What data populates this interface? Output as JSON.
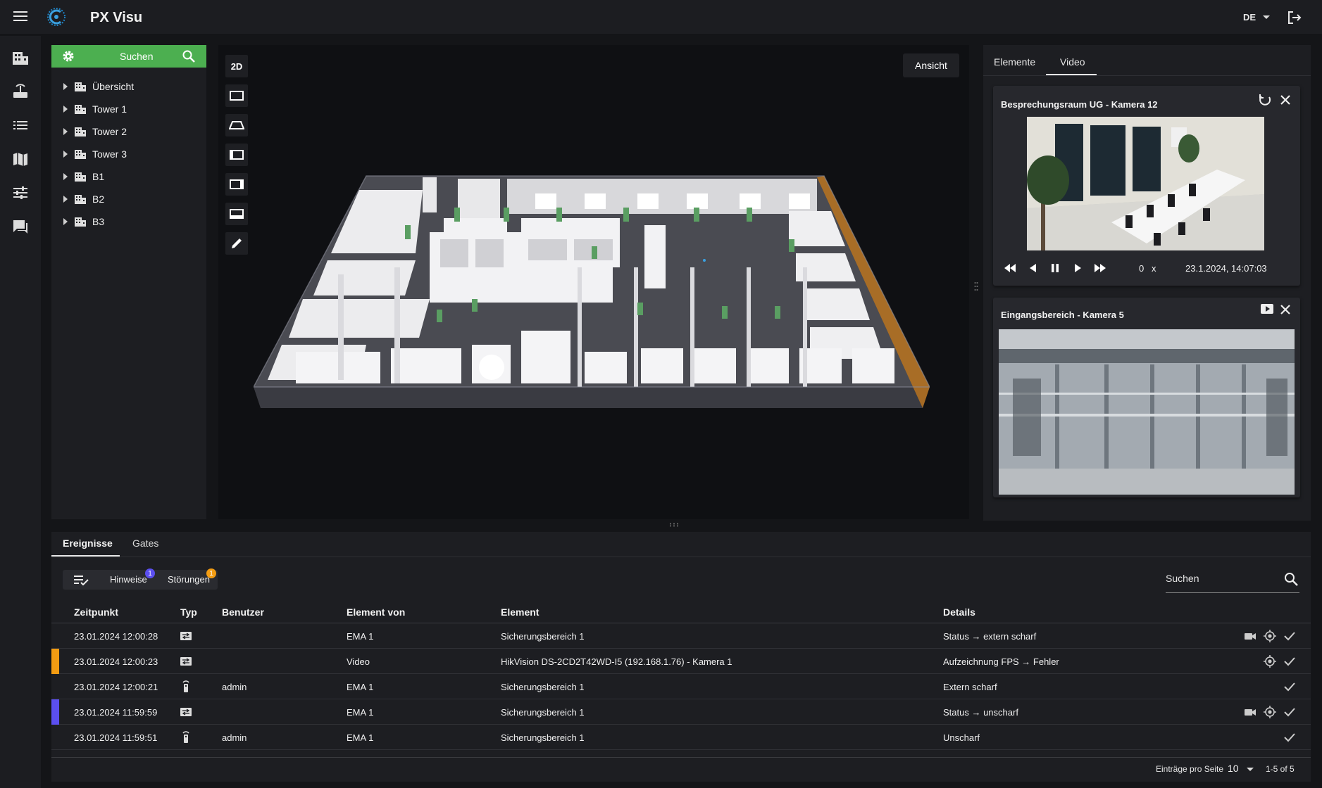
{
  "app": {
    "title": "PX Visu",
    "language": "DE"
  },
  "icons": {
    "menu": "menu-icon",
    "logo": "px-logo",
    "logout": "logout-icon",
    "rail": [
      "building-icon",
      "network-icon",
      "list-icon",
      "map-icon",
      "sliders-icon",
      "chat-icon"
    ]
  },
  "tree": {
    "search_label": "Suchen",
    "items": [
      {
        "label": "Übersicht"
      },
      {
        "label": "Tower 1"
      },
      {
        "label": "Tower 2"
      },
      {
        "label": "Tower 3"
      },
      {
        "label": "B1"
      },
      {
        "label": "B2"
      },
      {
        "label": "B3"
      }
    ]
  },
  "view": {
    "mode_2d_label": "2D",
    "ansicht_label": "Ansicht",
    "tools": [
      "view-top-icon",
      "view-perspective-icon",
      "view-left-icon",
      "view-right-icon",
      "view-bottom-icon",
      "pencil-icon"
    ]
  },
  "right_panel": {
    "tabs": [
      {
        "label": "Elemente"
      },
      {
        "label": "Video"
      }
    ],
    "active_tab": "Video",
    "cameras": [
      {
        "title": "Besprechungsraum UG - Kamera 12",
        "speed": "0",
        "speed_unit": "x",
        "timestamp": "23.1.2024, 14:07:03"
      },
      {
        "title": "Eingangsbereich - Kamera 5"
      }
    ]
  },
  "bottom_panel": {
    "tabs": [
      {
        "label": "Ereignisse"
      },
      {
        "label": "Gates"
      }
    ],
    "active_tab": "Ereignisse",
    "filters": [
      {
        "label": "Hinweise",
        "count": "1",
        "color": "#5b4ff0"
      },
      {
        "label": "Störungen",
        "count": "1",
        "color": "#f39c12"
      }
    ],
    "search_placeholder": "Suchen",
    "columns": [
      "Zeitpunkt",
      "Typ",
      "Benutzer",
      "Element von",
      "Element",
      "Details"
    ],
    "rows": [
      {
        "time": "23.01.2024 12:00:28",
        "type_icon": "transfer-icon",
        "user": "",
        "element_from": "EMA 1",
        "element": "Sicherungsbereich 1",
        "details": "Status → extern scharf",
        "accent": "",
        "has_video": true,
        "has_locate": true
      },
      {
        "time": "23.01.2024 12:00:23",
        "type_icon": "transfer-icon",
        "user": "",
        "element_from": "Video",
        "element": "HikVision DS-2CD2T42WD-I5 (192.168.1.76) - Kamera 1",
        "details": "Aufzeichnung FPS → Fehler",
        "accent": "#f39c12",
        "has_video": false,
        "has_locate": true
      },
      {
        "time": "23.01.2024 12:00:21",
        "type_icon": "remote-icon",
        "user": "admin",
        "element_from": "EMA 1",
        "element": "Sicherungsbereich 1",
        "details": "Extern scharf",
        "accent": "",
        "has_video": false,
        "has_locate": false
      },
      {
        "time": "23.01.2024 11:59:59",
        "type_icon": "transfer-icon",
        "user": "",
        "element_from": "EMA 1",
        "element": "Sicherungsbereich 1",
        "details": "Status → unscharf",
        "accent": "#5b4ff0",
        "has_video": true,
        "has_locate": true
      },
      {
        "time": "23.01.2024 11:59:51",
        "type_icon": "remote-icon",
        "user": "admin",
        "element_from": "EMA 1",
        "element": "Sicherungsbereich 1",
        "details": "Unscharf",
        "accent": "",
        "has_video": false,
        "has_locate": false
      }
    ],
    "pagination": {
      "label": "Einträge pro Seite",
      "per_page": "10",
      "range": "1-5 of 5"
    }
  },
  "colors": {
    "accent_green": "#4caf50",
    "orange": "#f39c12",
    "purple": "#5b4ff0",
    "floor_orange": "#b8731e"
  }
}
